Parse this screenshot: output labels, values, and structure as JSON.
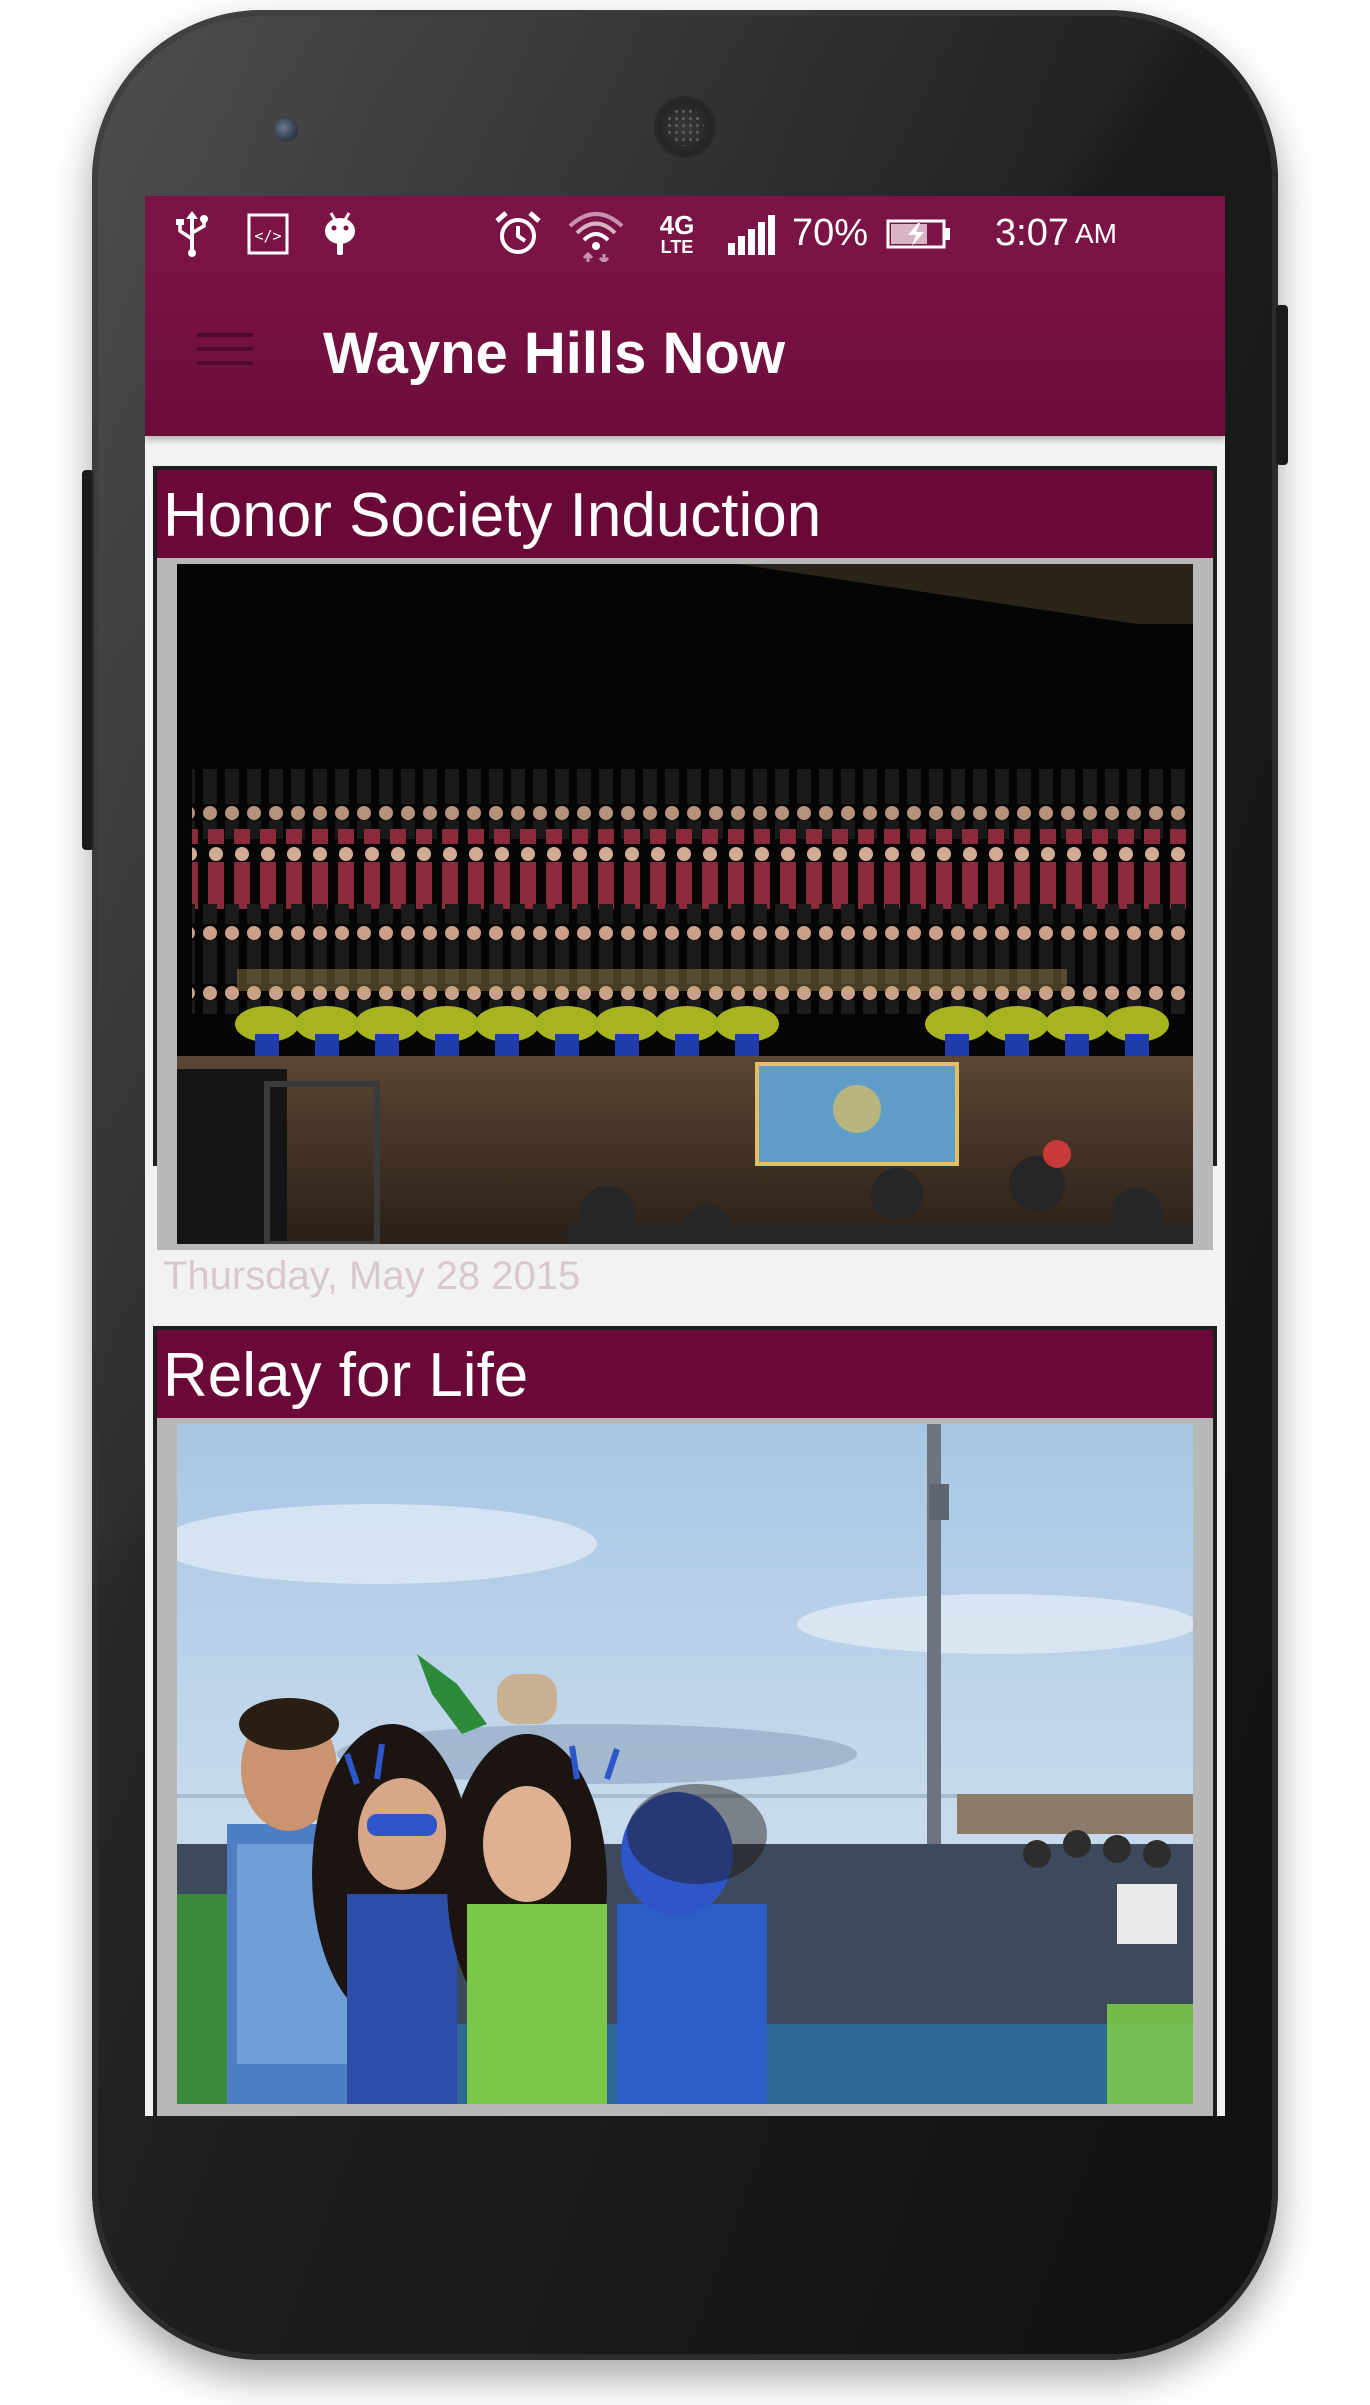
{
  "status_bar": {
    "battery_level": "70%",
    "time": "3:07",
    "ampm": "AM",
    "network": "4G",
    "network_sub": "LTE",
    "icons": [
      "usb-icon",
      "code-icon",
      "android-debug-icon",
      "alarm-icon",
      "wifi-icon",
      "signal-icon",
      "battery-charging-icon"
    ]
  },
  "app_bar": {
    "title": "Wayne Hills Now",
    "menu_icon": "hamburger-menu-icon"
  },
  "feed": {
    "items": [
      {
        "title": "Honor Society Induction",
        "date": "Thursday, May 28 2015",
        "image": "group-photo-on-stage"
      },
      {
        "title": "Relay for Life",
        "date": "",
        "image": "students-at-track-event"
      }
    ]
  },
  "colors": {
    "status_bar": "#7b1446",
    "app_bar": "#6c0d3c",
    "card_background": "#6a0838",
    "screen_background": "#f2f2f2"
  }
}
